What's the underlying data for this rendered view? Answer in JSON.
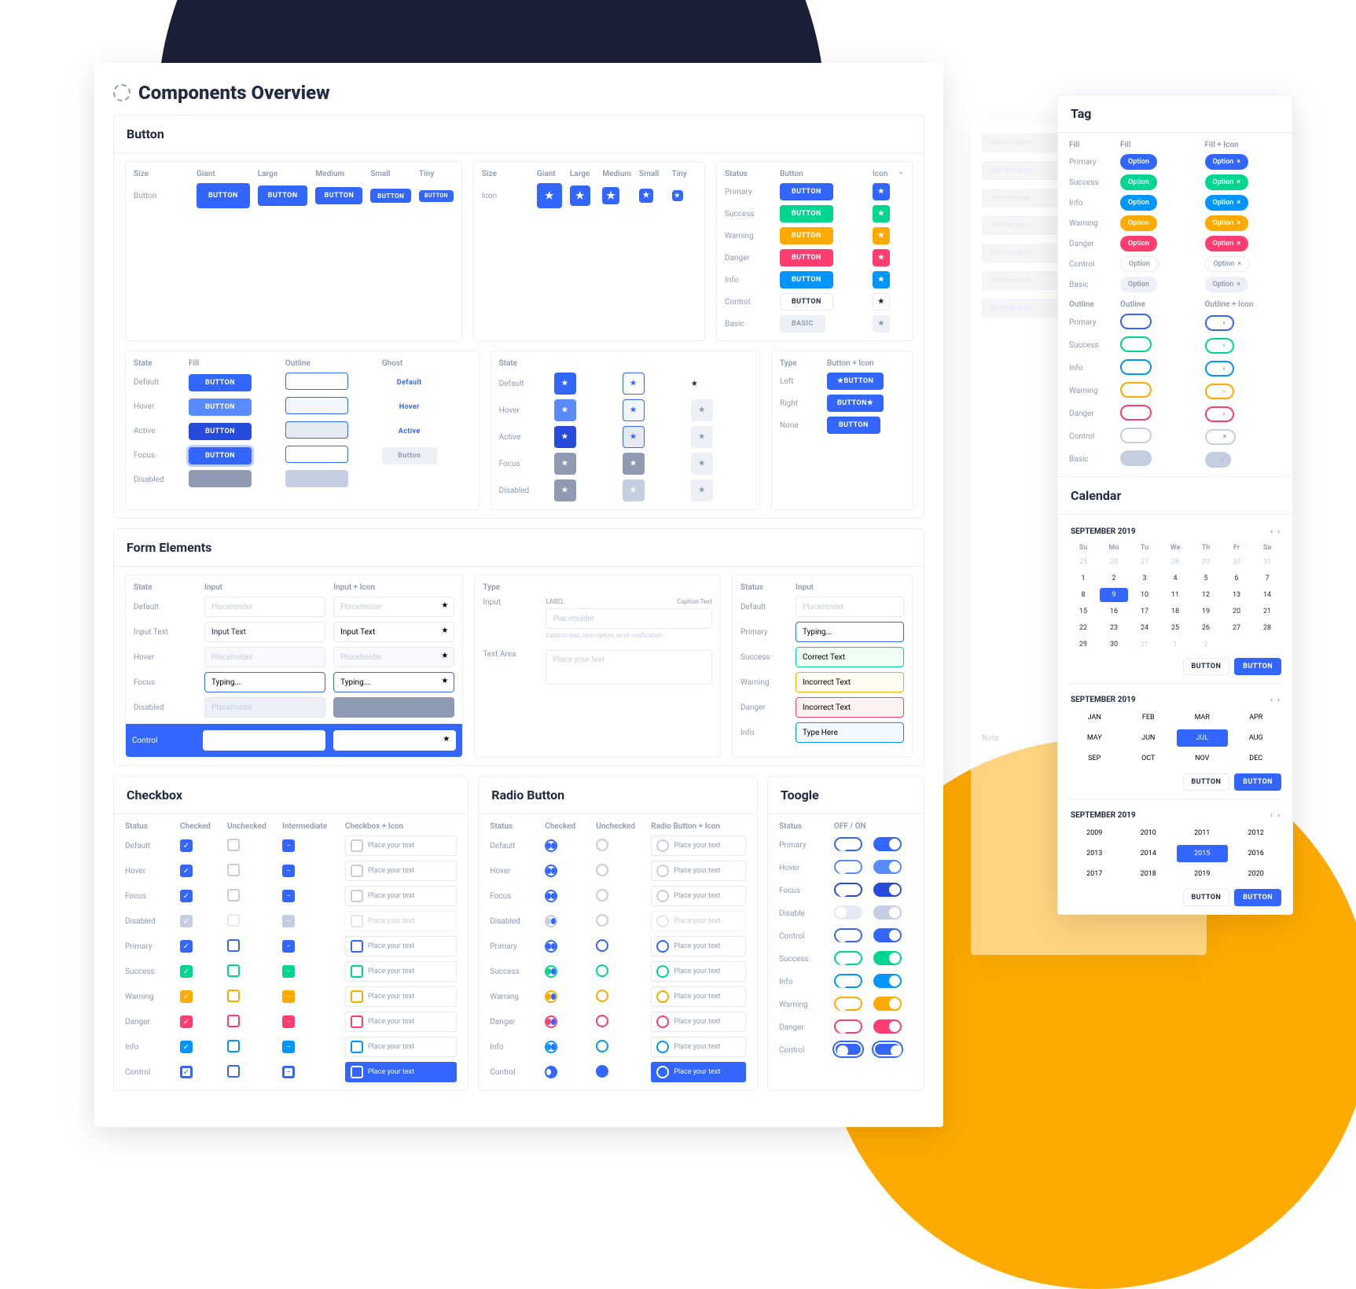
{
  "page_title": "Components Overview",
  "button": {
    "section": "Button",
    "size": {
      "header": "Size",
      "label_button": "Button",
      "label_icon": "Icon",
      "sizes": [
        "Giant",
        "Large",
        "Medium",
        "Small",
        "Tiny"
      ],
      "text": "BUTTON"
    },
    "state": {
      "header": "State",
      "cols": [
        "Fill",
        "Outline",
        "Ghost"
      ],
      "rows": [
        "Default",
        "Hover",
        "Active",
        "Focus",
        "Disabled"
      ],
      "text": "BUTTON",
      "ghost": [
        "Default",
        "Hover",
        "Active",
        "Button"
      ]
    },
    "state2": {
      "header": "State",
      "rows": [
        "Default",
        "Hover",
        "Active",
        "Focus",
        "Disabled"
      ]
    },
    "type": {
      "header": "Type",
      "col": "Button + Icon",
      "rows": [
        "Left",
        "Right",
        "None"
      ],
      "text": "BUTTON"
    },
    "status": {
      "header": "Status",
      "cols": [
        "Button",
        "Icon"
      ],
      "rows": [
        "Primary",
        "Success",
        "Warning",
        "Danger",
        "Info",
        "Control",
        "Basic"
      ],
      "text": "BUTTON",
      "basic": "BASIC"
    }
  },
  "form": {
    "section": "Form Elements",
    "state": {
      "header": "State",
      "cols": [
        "Input",
        "Input + Icon"
      ],
      "rows": [
        "Default",
        "Input Text",
        "Hover",
        "Focus",
        "Disabled",
        "Control"
      ],
      "ph": "Placeholder",
      "it": "Input Text",
      "typing": "Typing..."
    },
    "type": {
      "header": "Type",
      "rows": [
        "Input",
        "Text Area"
      ],
      "label": "LABEL",
      "caption": "Caption Text",
      "note": "Caption text, description, error notification",
      "ph": "Placeholder",
      "taph": "Place your text"
    },
    "status": {
      "header": "Status",
      "col": "Input",
      "rows": [
        "Default",
        "Primary",
        "Success",
        "Warning",
        "Danger",
        "Info"
      ],
      "vals": [
        "Placeholder",
        "Typing...",
        "Correct Text",
        "Incorrect Text",
        "Incorrect Text",
        "Type Here"
      ]
    }
  },
  "checkbox": {
    "section": "Checkbox",
    "header": "Status",
    "cols": [
      "Checked",
      "Unchecked",
      "Intermediate",
      "Checkbox + Icon"
    ],
    "rows": [
      "Default",
      "Hover",
      "Focus",
      "Disabled",
      "Primary",
      "Success",
      "Warning",
      "Danger",
      "Info",
      "Control"
    ],
    "label": "Place your text"
  },
  "radio": {
    "section": "Radio Button",
    "header": "Status",
    "cols": [
      "Checked",
      "Unchecked",
      "Radio Button + Icon"
    ],
    "rows": [
      "Default",
      "Hover",
      "Focus",
      "Disabled",
      "Primary",
      "Success",
      "Warning",
      "Danger",
      "Info",
      "Control"
    ],
    "label": "Place your text"
  },
  "toggle": {
    "section": "Toogle",
    "header": "Status",
    "col": "OFF / ON",
    "rows": [
      "Primary",
      "Hover",
      "Focus",
      "Disable",
      "Control",
      "Success",
      "Info",
      "Warning",
      "Danger",
      "Control"
    ]
  },
  "tag": {
    "section": "Tag",
    "fill": {
      "header": "Fill",
      "cols": [
        "Fill",
        "Fill + Icon"
      ],
      "rows": [
        "Primary",
        "Success",
        "Info",
        "Warning",
        "Danger",
        "Control",
        "Basic"
      ],
      "text": "Option"
    },
    "outline": {
      "header": "Outline",
      "cols": [
        "Outline",
        "Outline + Icon"
      ],
      "rows": [
        "Primary",
        "Success",
        "Info",
        "Warning",
        "Danger",
        "Control",
        "Basic"
      ]
    }
  },
  "calendar": {
    "section": "Calendar",
    "month": "SEPTEMBER 2019",
    "dow": [
      "Su",
      "Mo",
      "Tu",
      "We",
      "Th",
      "Fr",
      "Sa"
    ],
    "days": [
      25,
      26,
      27,
      28,
      29,
      30,
      31,
      1,
      2,
      3,
      4,
      5,
      6,
      7,
      8,
      9,
      10,
      11,
      12,
      13,
      14,
      15,
      16,
      17,
      18,
      19,
      20,
      21,
      22,
      23,
      24,
      25,
      26,
      27,
      28,
      29,
      30,
      31,
      1,
      2
    ],
    "selected": 9,
    "months": [
      "JAN",
      "FEB",
      "MAR",
      "APR",
      "MAY",
      "JUN",
      "JUL",
      "AUG",
      "SEP",
      "OCT",
      "NOV",
      "DEC"
    ],
    "sel_month": "JUL",
    "years": [
      2009,
      2010,
      2011,
      2012,
      2013,
      2014,
      2015,
      2016,
      2017,
      2018,
      2019,
      2020
    ],
    "sel_year": 2015,
    "btn_cancel": "BUTTON",
    "btn_ok": "BUTTON"
  },
  "back": {
    "ph": "dd/mm/yyyy",
    "note": "Note"
  }
}
